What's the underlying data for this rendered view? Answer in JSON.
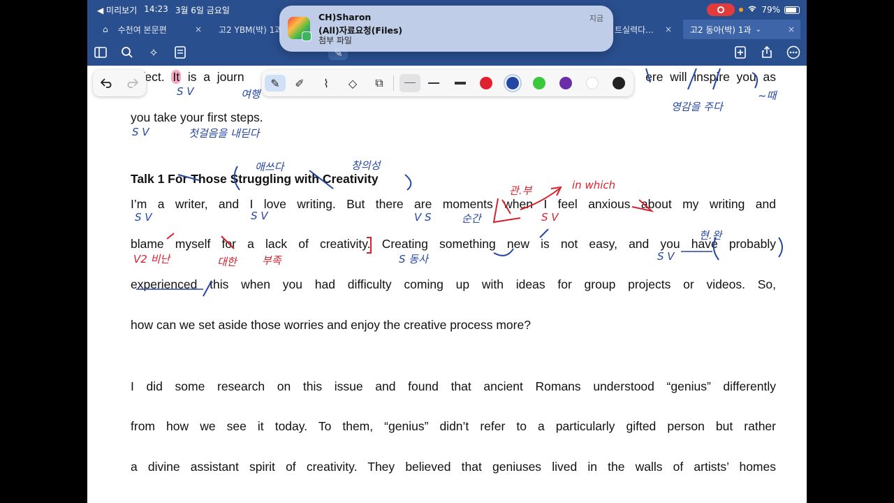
{
  "status": {
    "back_label": "◀ 미리보기",
    "time": "14:23",
    "date": "3월 6일 금요일",
    "battery": "79%"
  },
  "tabs": [
    {
      "label": "수천여 본문편"
    },
    {
      "label": "고2 YBM(박) 1과"
    },
    {
      "label": "트실력다..."
    },
    {
      "label": "고2 동아(박) 1과"
    }
  ],
  "notification": {
    "sender": "CH)Sharon",
    "subject": "(All)자료요청(Files)",
    "body": "첨부 파일",
    "time": "지금"
  },
  "colors": {
    "header_bg": "#2a4f8f",
    "swatches": [
      "#e0202c",
      "#2447a6",
      "#3cc83c",
      "#6a2fa8",
      "#ffffff",
      "#222222"
    ]
  },
  "doc": {
    "line1": {
      "pre": "erfect. ",
      "hl": "It",
      "post": " is a journ                                                           ere will inspire you as"
    },
    "line2": "you take your first steps.",
    "heading": "Talk 1 For Those Struggling with Creativity",
    "p1": [
      " I’m a writer, and I love writing. But there are moments when I feel anxious about my writing and",
      "blame myself for a lack of creativity. Creating something new is not easy, and you have probably",
      "experienced this when you had difficulty coming up with ideas for group projects or videos. So,",
      "how can we set aside those worries and enjoy the creative process more?"
    ],
    "p2": [
      " I did some research on this issue and found that ancient Romans understood “genius” differently",
      "from how we see it today. To them, “genius” didn’t refer to a particularly gifted person but rather",
      "a divine assistant spirit of creativity. They believed that geniuses lived in the walls of artists’ homes"
    ]
  },
  "ink": {
    "blue": [
      {
        "text": "S  V",
        "id": "sv1"
      },
      {
        "text": "여행",
        "id": "yh"
      },
      {
        "text": "영감을 주다",
        "id": "yg"
      },
      {
        "text": "~때",
        "id": "ttae"
      },
      {
        "text": "S   V",
        "id": "sv2"
      },
      {
        "text": "첫걸음을 내딛다",
        "id": "cg"
      },
      {
        "text": "애쓰다",
        "id": "as"
      },
      {
        "text": "창의성",
        "id": "cu"
      },
      {
        "text": "S V",
        "id": "sv3"
      },
      {
        "text": "S  V",
        "id": "sv4"
      },
      {
        "text": "V  S",
        "id": "vs"
      },
      {
        "text": "순간",
        "id": "sg"
      },
      {
        "text": "S 동사",
        "id": "sd"
      },
      {
        "text": "S  V",
        "id": "sv5"
      },
      {
        "text": "현.완",
        "id": "hw"
      }
    ],
    "red": [
      {
        "text": "관.부",
        "id": "gb"
      },
      {
        "text": "in which",
        "id": "iw"
      },
      {
        "text": "S V",
        "id": "sv6"
      },
      {
        "text": "V2 비난",
        "id": "bn"
      },
      {
        "text": "대한",
        "id": "dh"
      },
      {
        "text": "부족",
        "id": "bj"
      }
    ]
  }
}
